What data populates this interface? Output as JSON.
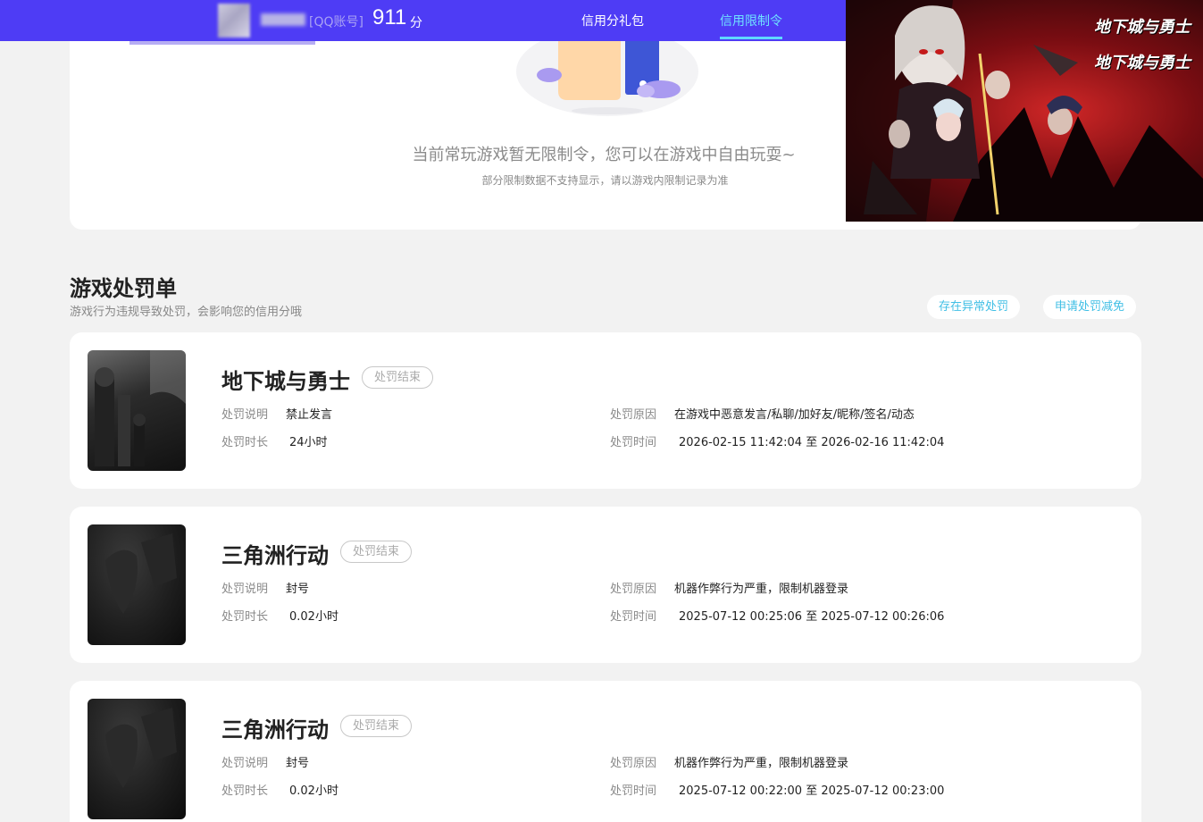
{
  "header": {
    "account_type": "[QQ账号]",
    "score": "911",
    "score_unit": "分",
    "tabs": [
      {
        "label": "信用分礼包",
        "active": false
      },
      {
        "label": "信用限制令",
        "active": true
      }
    ],
    "bar_color": "#4e3cf5",
    "active_tab_color": "#6fe2ff"
  },
  "restriction": {
    "empty_message": "当前常玩游戏暂无限制令，您可以在游戏中自由玩耍~",
    "empty_note": "部分限制数据不支持显示，请以游戏内限制记录为准"
  },
  "ad": {
    "logo_text": "地下城与勇士"
  },
  "penalties": {
    "title": "游戏处罚单",
    "description": "游戏行为违规导致处罚，会影响您的信用分哦",
    "abnormal_button": "存在异常处罚",
    "appeal_button": "申请处罚减免",
    "field_labels": {
      "desc": "处罚说明",
      "reason": "处罚原因",
      "duration": "处罚时长",
      "time": "处罚时间"
    },
    "items": [
      {
        "game": "地下城与勇士",
        "status": "处罚结束",
        "desc": "禁止发言",
        "reason": "在游戏中恶意发言/私聊/加好友/昵称/签名/动态",
        "duration": "24小时",
        "time": "2026-02-15 11:42:04 至 2026-02-16 11:42:04"
      },
      {
        "game": "三角洲行动",
        "status": "处罚结束",
        "desc": "封号",
        "reason": "机器作弊行为严重，限制机器登录",
        "duration": "0.02小时",
        "time": "2025-07-12 00:25:06 至 2025-07-12 00:26:06"
      },
      {
        "game": "三角洲行动",
        "status": "处罚结束",
        "desc": "封号",
        "reason": "机器作弊行为严重，限制机器登录",
        "duration": "0.02小时",
        "time": "2025-07-12 00:22:00 至 2025-07-12 00:23:00"
      }
    ]
  }
}
